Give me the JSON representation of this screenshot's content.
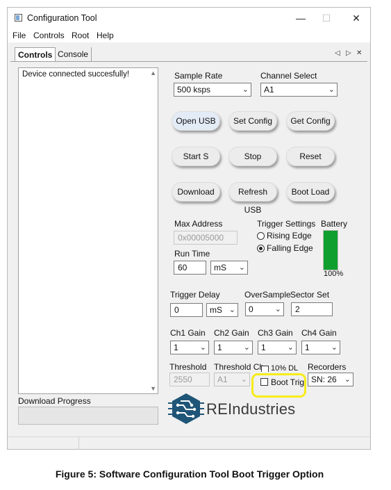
{
  "window": {
    "title": "Configuration Tool",
    "minimize_glyph": "—",
    "maximize_glyph": "☐",
    "close_glyph": "✕"
  },
  "menu": [
    "File",
    "Controls",
    "Root",
    "Help"
  ],
  "tabs": {
    "items": [
      "Controls",
      "Console"
    ],
    "active": "Controls",
    "nav_prev": "◁",
    "nav_next": "▷",
    "nav_close": "✕"
  },
  "log": {
    "text": "Device connected succesfully!",
    "scroll_up": "▲",
    "scroll_down": "▼"
  },
  "sample_rate": {
    "label": "Sample Rate",
    "value": "500 ksps"
  },
  "channel_select": {
    "label": "Channel Select",
    "value": "A1"
  },
  "buttons": {
    "open_usb": "Open USB",
    "set_config": "Set Config",
    "get_config": "Get Config",
    "start": "Start S",
    "stop": "Stop",
    "reset": "Reset",
    "download": "Download",
    "refresh_usb": "Refresh USB",
    "boot_load": "Boot Load"
  },
  "max_address": {
    "label": "Max Address",
    "value": "0x00005000"
  },
  "run_time": {
    "label": "Run Time",
    "value": "60",
    "unit": "mS"
  },
  "trigger_settings": {
    "label": "Trigger Settings",
    "options": [
      "Rising Edge",
      "Falling Edge"
    ],
    "selected": "Falling Edge"
  },
  "battery": {
    "label": "Battery",
    "percent_text": "100%",
    "level": 1.0,
    "color": "#0f9f2e"
  },
  "trigger_delay": {
    "label": "Trigger Delay",
    "value": "0",
    "unit": "mS"
  },
  "oversample": {
    "label": "OverSample",
    "value": "0"
  },
  "sector_set": {
    "label": "Sector Set",
    "value": "2"
  },
  "gains": [
    {
      "label": "Ch1 Gain",
      "value": "1"
    },
    {
      "label": "Ch2 Gain",
      "value": "1"
    },
    {
      "label": "Ch3 Gain",
      "value": "1"
    },
    {
      "label": "Ch4 Gain",
      "value": "1"
    }
  ],
  "threshold": {
    "label": "Threshold",
    "value": "2550"
  },
  "threshold_ch": {
    "label": "Threshold Ch",
    "value": "A1"
  },
  "ten_pct_dl": {
    "label": "10% DL",
    "checked": false
  },
  "boot_trig": {
    "label": "Boot Trig",
    "checked": false
  },
  "recorders": {
    "label": "Recorders",
    "value": "SN: 26"
  },
  "download_progress": {
    "label": "Download Progress",
    "value": 0
  },
  "logo": {
    "text": "REIndustries",
    "color": "#1f5577"
  },
  "highlight_color": "#f7ec1a",
  "caption": "Figure 5: Software Configuration Tool Boot Trigger Option"
}
